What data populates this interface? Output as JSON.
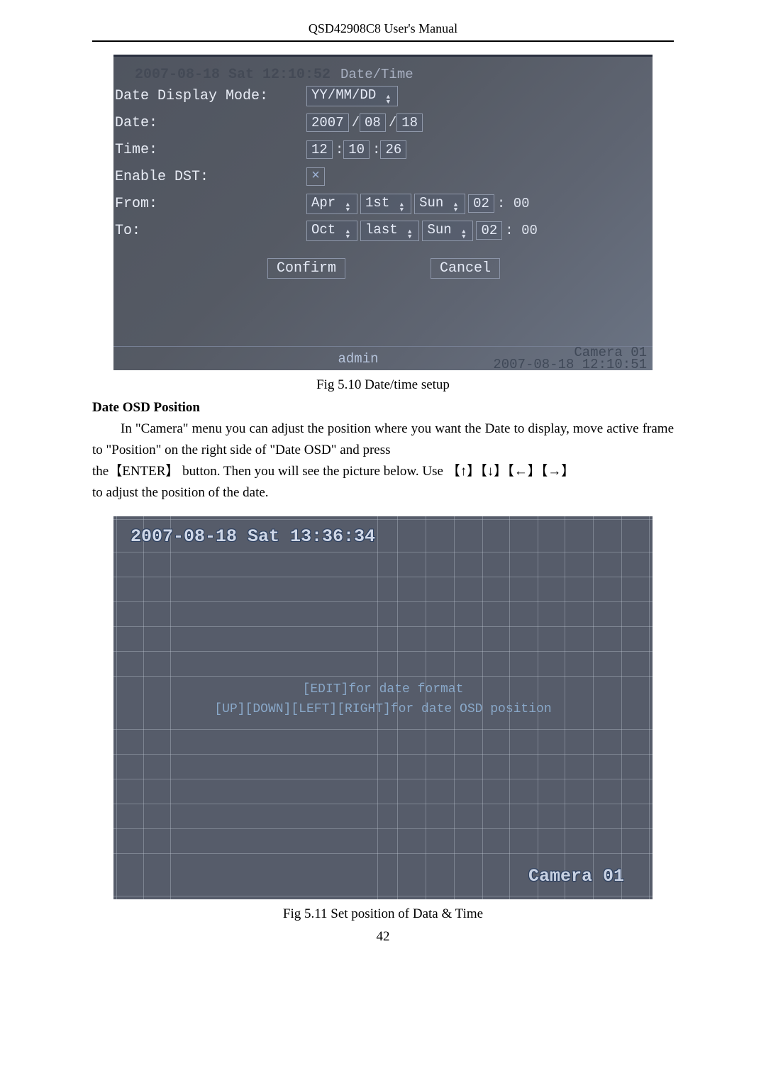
{
  "header": "QSD42908C8 User's Manual",
  "fig1": {
    "ghost_header": "2007-08-18 Sat 12:10:52",
    "title": "Date/Time",
    "labels": {
      "display_mode": "Date Display Mode:",
      "date": "Date:",
      "time": "Time:",
      "enable_dst": "Enable DST:",
      "from": "From:",
      "to": "To:"
    },
    "values": {
      "display_mode": "YY/MM/DD",
      "date_year": "2007",
      "date_month": "08",
      "date_day": "18",
      "time_h": "12",
      "time_m": "10",
      "time_s": "26",
      "from_month": "Apr",
      "from_week": "1st",
      "from_day": "Sun",
      "from_hour": "02",
      "from_min": ": 00",
      "to_month": "Oct",
      "to_week": "last",
      "to_day": "Sun",
      "to_hour": "02",
      "to_min": ": 00",
      "dst_checked": "×"
    },
    "buttons": {
      "confirm": "Confirm",
      "cancel": "Cancel"
    },
    "status": {
      "user": "admin",
      "camera_label": "Camera 01",
      "timestamp": "2007-08-18 12:10:51"
    },
    "caption": "Fig 5.10 Date/time setup"
  },
  "section": {
    "heading": "Date OSD Position",
    "paragraph1_a": "In \"Camera\" menu you can adjust the position where you want the Date to display, move active frame to \"Position\" on the right side of \"Date OSD\" and press",
    "paragraph1_b": "the【ENTER】 button. Then you will see the picture below. Use  【↑】【↓】【←】【→】",
    "paragraph1_c": "to adjust the position of the date."
  },
  "fig2": {
    "osd": "2007-08-18 Sat 13:36:34",
    "instr_line1": "[EDIT]for date format",
    "instr_line2": "[UP][DOWN][LEFT][RIGHT]for date OSD position",
    "camera": "Camera 01",
    "caption": "Fig 5.11 Set position of Data & Time"
  },
  "page_number": "42"
}
